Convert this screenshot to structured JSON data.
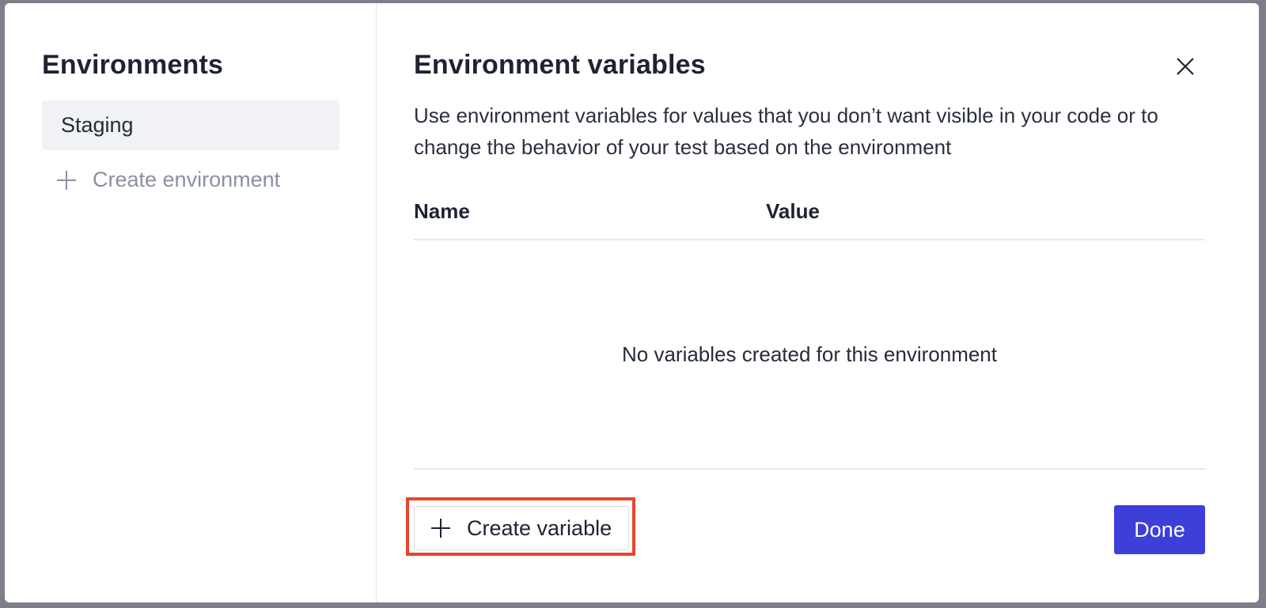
{
  "sidebar": {
    "title": "Environments",
    "items": [
      {
        "label": "Staging"
      }
    ],
    "create_label": "Create environment",
    "create_icon": "plus-icon"
  },
  "main": {
    "title": "Environment variables",
    "close_icon": "close-icon",
    "description": "Use environment variables for values that you don’t want visible in your code or to change the behavior of your test based on the environment",
    "table": {
      "columns": [
        "Name",
        "Value"
      ],
      "rows": [],
      "empty_message": "No variables created for this environment"
    },
    "footer": {
      "create_label": "Create variable",
      "create_icon": "plus-icon",
      "done_label": "Done"
    }
  },
  "colors": {
    "accent": "#3d3fd9",
    "highlight": "#e5472b",
    "overlay": "#7c7f88"
  }
}
